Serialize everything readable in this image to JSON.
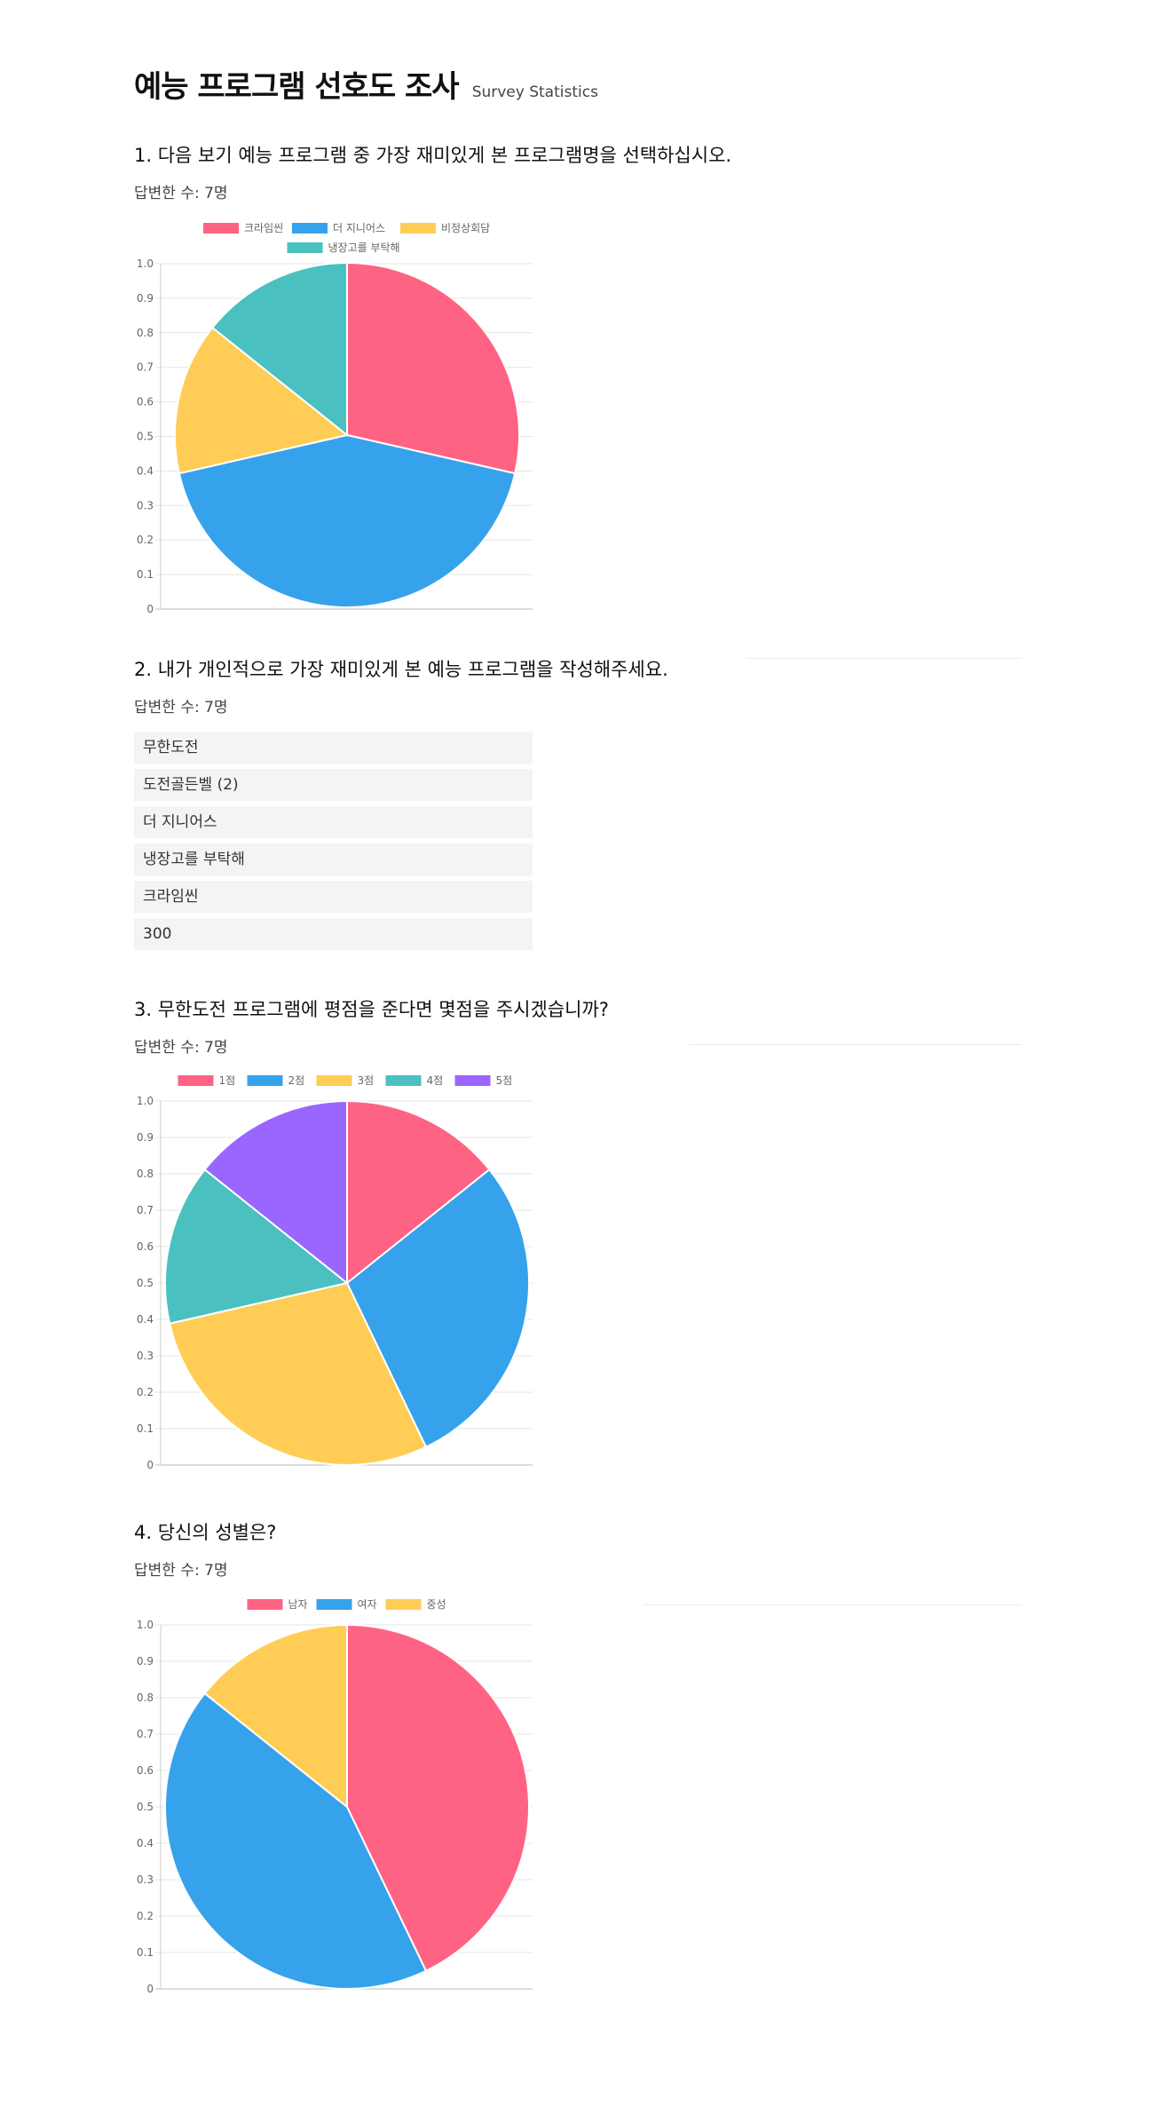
{
  "header": {
    "title": "예능 프로그램 선호도 조사",
    "subtitle": "Survey Statistics"
  },
  "questions": [
    {
      "title": "1. 다음 보기 예능 프로그램 중 가장 재미있게 본 프로그램명을 선택하십시오.",
      "count": "답변한 수: 7명"
    },
    {
      "title": "2. 내가 개인적으로 가장 재미있게 본 예능 프로그램을 작성해주세요.",
      "count": "답변한 수: 7명",
      "answers": [
        "무한도전",
        "도전골든벨 (2)",
        "더 지니어스",
        "냉장고를 부탁해",
        "크라임씬",
        "300"
      ]
    },
    {
      "title": "3. 무한도전 프로그램에 평점을 준다면 몇점을 주시겠습니까?",
      "count": "답변한 수: 7명"
    },
    {
      "title": "4. 당신의 성별은?",
      "count": "답변한 수: 7명"
    }
  ],
  "chart_data": [
    {
      "type": "pie",
      "categories": [
        "크라임씬",
        "더 지니어스",
        "비정상회담",
        "냉장고를 부탁해"
      ],
      "values": [
        2,
        3,
        1,
        1
      ],
      "colors": [
        "#ff6384",
        "#36a2eb",
        "#ffcd56",
        "#4bc0c0"
      ],
      "yticks": [
        "0",
        "0.1",
        "0.2",
        "0.3",
        "0.4",
        "0.5",
        "0.6",
        "0.7",
        "0.8",
        "0.9",
        "1.0"
      ],
      "ylim": [
        0,
        1
      ],
      "grid": true,
      "legend": "top"
    },
    {
      "type": "pie",
      "categories": [
        "1점",
        "2점",
        "3점",
        "4점",
        "5점"
      ],
      "values": [
        1,
        2,
        2,
        1,
        1
      ],
      "colors": [
        "#ff6384",
        "#36a2eb",
        "#ffcd56",
        "#4bc0c0",
        "#9966ff"
      ],
      "yticks": [
        "0",
        "0.1",
        "0.2",
        "0.3",
        "0.4",
        "0.5",
        "0.6",
        "0.7",
        "0.8",
        "0.9",
        "1.0"
      ],
      "ylim": [
        0,
        1
      ],
      "grid": true,
      "legend": "top"
    },
    {
      "type": "pie",
      "categories": [
        "남자",
        "여자",
        "중성"
      ],
      "values": [
        3,
        3,
        1
      ],
      "colors": [
        "#ff6384",
        "#36a2eb",
        "#ffcd56"
      ],
      "yticks": [
        "0",
        "0.1",
        "0.2",
        "0.3",
        "0.4",
        "0.5",
        "0.6",
        "0.7",
        "0.8",
        "0.9",
        "1.0"
      ],
      "ylim": [
        0,
        1
      ],
      "grid": true,
      "legend": "top"
    }
  ]
}
